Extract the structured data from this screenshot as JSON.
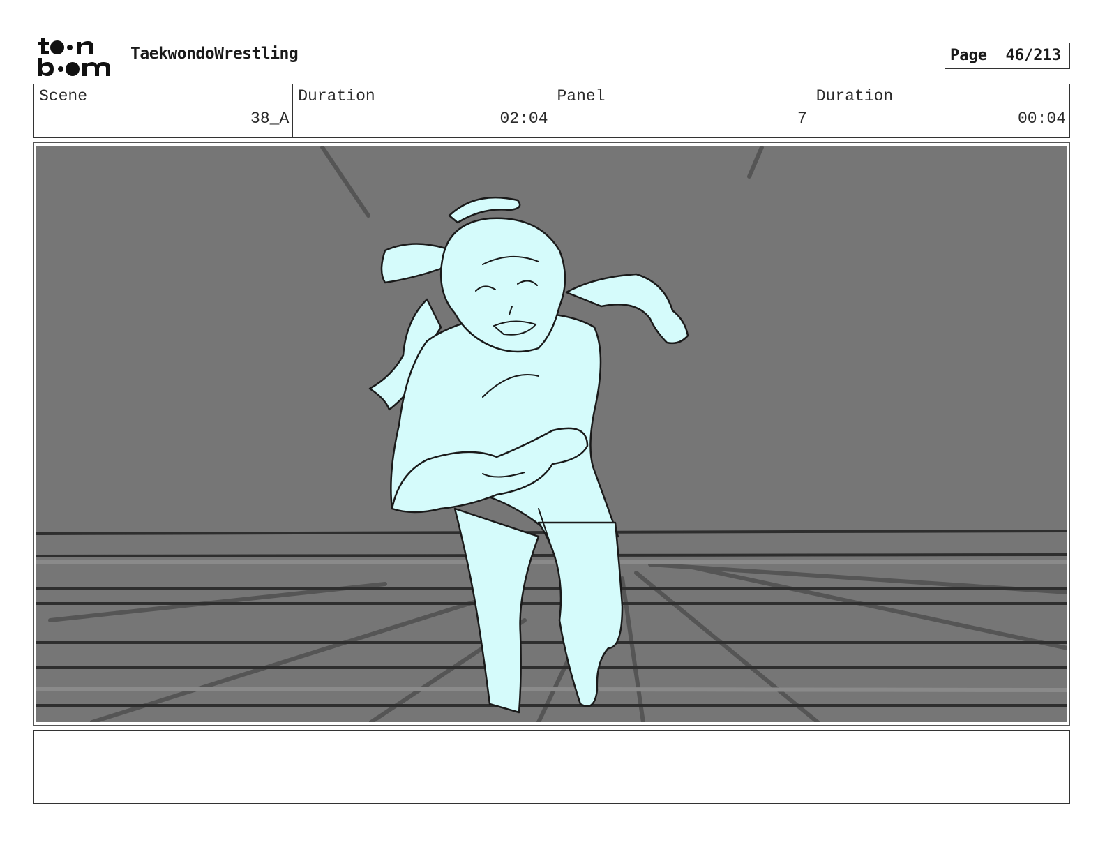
{
  "header": {
    "logo_text_top": "toon",
    "logo_text_bottom": "boom",
    "project_title": "TaekwondoWrestling",
    "page_label": "Page",
    "page_value": "46/213"
  },
  "info": {
    "scene_label": "Scene",
    "scene_value": "38_A",
    "duration_label": "Duration",
    "duration_value": "02:04",
    "panel_label": "Panel",
    "panel_value": "7",
    "panel_duration_label": "Duration",
    "panel_duration_value": "00:04"
  },
  "panel": {
    "background_color": "#767676",
    "figure_fill": "#d5fbfb",
    "line_color": "#1a1a1a"
  },
  "notes": {
    "text": ""
  }
}
